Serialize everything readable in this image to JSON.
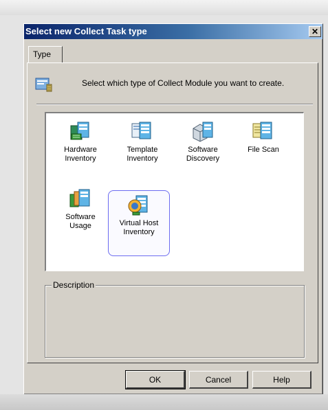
{
  "window": {
    "title": "Select new Collect Task type",
    "close_glyph": "✕"
  },
  "tabs": [
    {
      "label": "Type",
      "selected": true
    }
  ],
  "header": {
    "icon": "collect-module-icon",
    "text": "Select which type of Collect Module you want to create."
  },
  "module_types": [
    {
      "line1": "Hardware",
      "line2": "Inventory",
      "icon": "hardware-inventory-icon",
      "selected": false
    },
    {
      "line1": "Template",
      "line2": "Inventory",
      "icon": "template-inventory-icon",
      "selected": false
    },
    {
      "line1": "Software",
      "line2": "Discovery",
      "icon": "software-discovery-icon",
      "selected": false
    },
    {
      "line1": "File Scan",
      "line2": "",
      "icon": "file-scan-icon",
      "selected": false
    },
    {
      "line1": "Software",
      "line2": "Usage",
      "icon": "software-usage-icon",
      "selected": false
    },
    {
      "line1": "Virtual Host",
      "line2": "Inventory",
      "icon": "virtual-host-inventory-icon",
      "selected": true
    }
  ],
  "description": {
    "label": "Description",
    "text": ""
  },
  "buttons": {
    "ok": "OK",
    "cancel": "Cancel",
    "help": "Help"
  },
  "colors": {
    "titlebar_start": "#0a246a",
    "titlebar_end": "#a6caf0",
    "dialog_face": "#d4d0c8",
    "selection_border": "#6b6bf0"
  }
}
